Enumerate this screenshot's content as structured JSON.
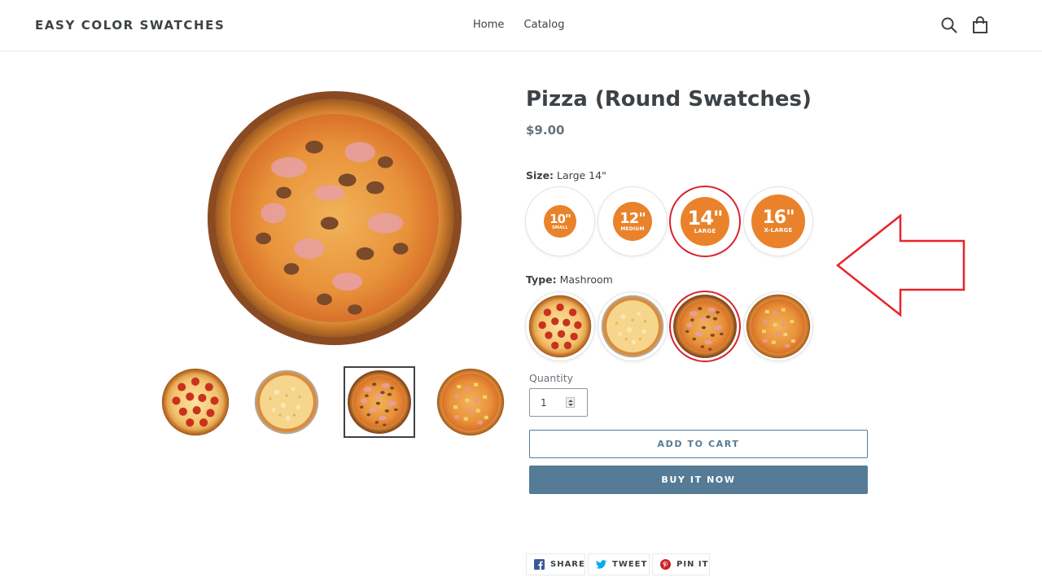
{
  "header": {
    "store_name": "EASY COLOR SWATCHES",
    "nav": [
      "Home",
      "Catalog"
    ],
    "icons": [
      "search-icon",
      "cart-icon"
    ]
  },
  "product": {
    "title": "Pizza (Round Swatches)",
    "price": "$9.00",
    "size_option": {
      "label": "Size:",
      "selected": "Large 14\"",
      "swatches": [
        {
          "num": "10\"",
          "sub": "SMALL",
          "selected": false
        },
        {
          "num": "12\"",
          "sub": "MEDIUM",
          "selected": false
        },
        {
          "num": "14\"",
          "sub": "LARGE",
          "selected": true
        },
        {
          "num": "16\"",
          "sub": "X-LARGE",
          "selected": false
        }
      ]
    },
    "type_option": {
      "label": "Type:",
      "selected": "Mashroom",
      "swatches": [
        "pepperoni-pizza",
        "cheese-pizza",
        "mushroom-pizza",
        "hawaiian-pizza"
      ],
      "selected_index": 2
    },
    "quantity": {
      "label": "Quantity",
      "value": "1"
    },
    "buttons": {
      "add_to_cart": "ADD TO CART",
      "buy_now": "BUY IT NOW"
    },
    "thumbnails_active_index": 2,
    "share": {
      "facebook": "SHARE",
      "twitter": "TWEET",
      "pinterest": "PIN IT"
    }
  },
  "colors": {
    "accent": "#557b97",
    "selection_ring": "#d9232d",
    "size_badge": "#e9822a",
    "annotation_arrow": "#e8242b"
  }
}
